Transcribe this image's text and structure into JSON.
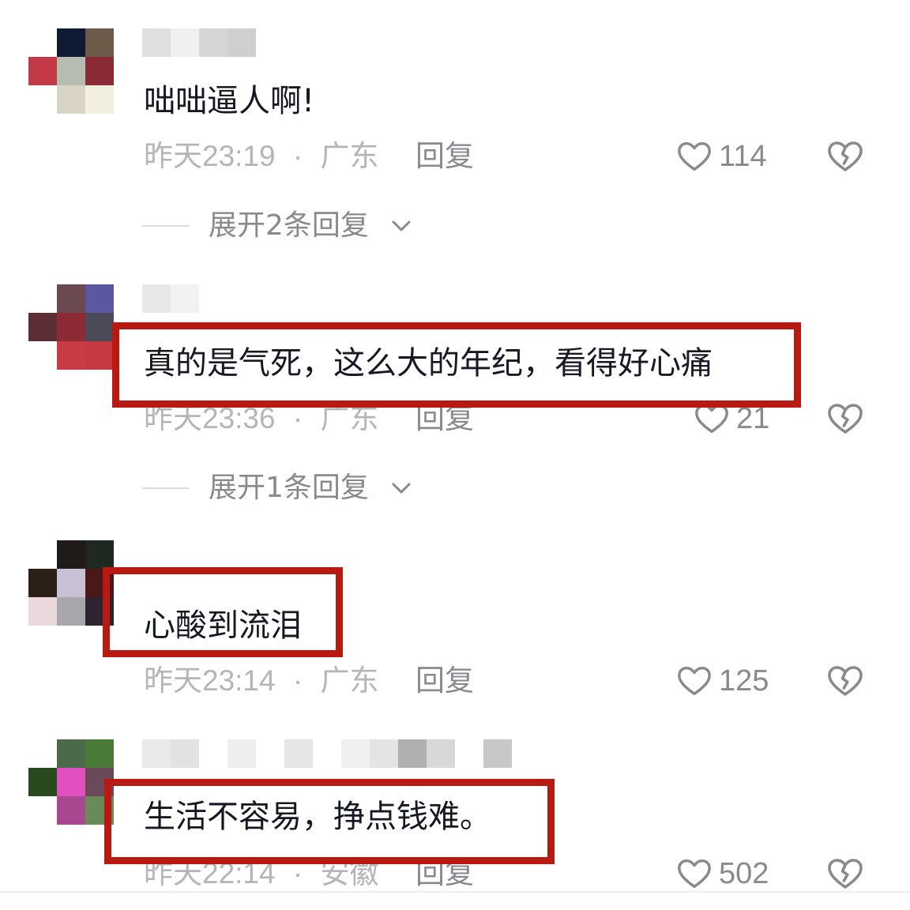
{
  "comments": [
    {
      "text": "咄咄逼人啊!",
      "time": "昨天23:19",
      "location": "广东",
      "separator": "·",
      "reply_label": "回复",
      "likes": "114",
      "expand_label": "展开2条回复",
      "highlighted": false
    },
    {
      "text": "真的是气死，这么大的年纪，看得好心痛",
      "time": "昨天23:36",
      "location": "广东",
      "separator": "·",
      "reply_label": "回复",
      "likes": "21",
      "expand_label": "展开1条回复",
      "highlighted": true
    },
    {
      "text": "心酸到流泪",
      "time": "昨天23:14",
      "location": "广东",
      "separator": "·",
      "reply_label": "回复",
      "likes": "125",
      "highlighted": true
    },
    {
      "text": "生活不容易，挣点钱难。",
      "time": "昨天22:14",
      "location": "安徽",
      "separator": "·",
      "reply_label": "回复",
      "likes": "502",
      "highlighted": true
    }
  ],
  "colors": {
    "highlight_border": "#b81a12",
    "text_primary": "#161823",
    "text_secondary": "#8a8a8e",
    "text_meta": "#b5b5b8"
  },
  "icons": {
    "like": "heart-outline-icon",
    "dislike": "broken-heart-icon",
    "expand": "chevron-down-icon"
  }
}
